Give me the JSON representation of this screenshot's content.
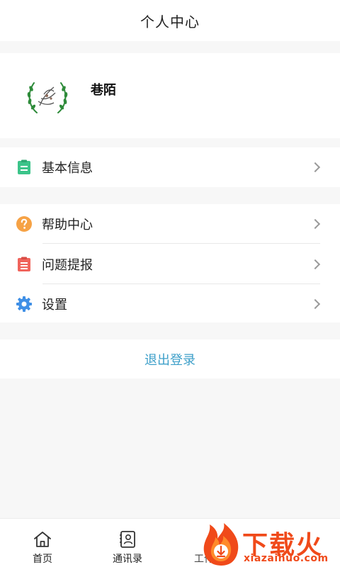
{
  "header": {
    "title": "个人中心"
  },
  "profile": {
    "username": "巷陌",
    "avatar_icon": "laurel-wreath-logo"
  },
  "menu_basic": [
    {
      "label": "基本信息",
      "icon": "clipboard-icon",
      "color": "#3cc48a"
    }
  ],
  "menu_main": [
    {
      "label": "帮助中心",
      "icon": "question-circle-icon",
      "color": "#f6a245"
    },
    {
      "label": "问题提报",
      "icon": "report-clipboard-icon",
      "color": "#f0645c"
    },
    {
      "label": "设置",
      "icon": "gear-icon",
      "color": "#3f8fe6"
    }
  ],
  "logout": {
    "label": "退出登录",
    "color": "#3d9fc9"
  },
  "tabbar": {
    "tabs": [
      {
        "label": "首页",
        "icon": "home-icon"
      },
      {
        "label": "通讯录",
        "icon": "contacts-icon"
      },
      {
        "label": "工作台",
        "icon": "workbench-icon"
      }
    ]
  },
  "watermark": {
    "brand": "下载火",
    "url": "xiazaihuo.com"
  }
}
